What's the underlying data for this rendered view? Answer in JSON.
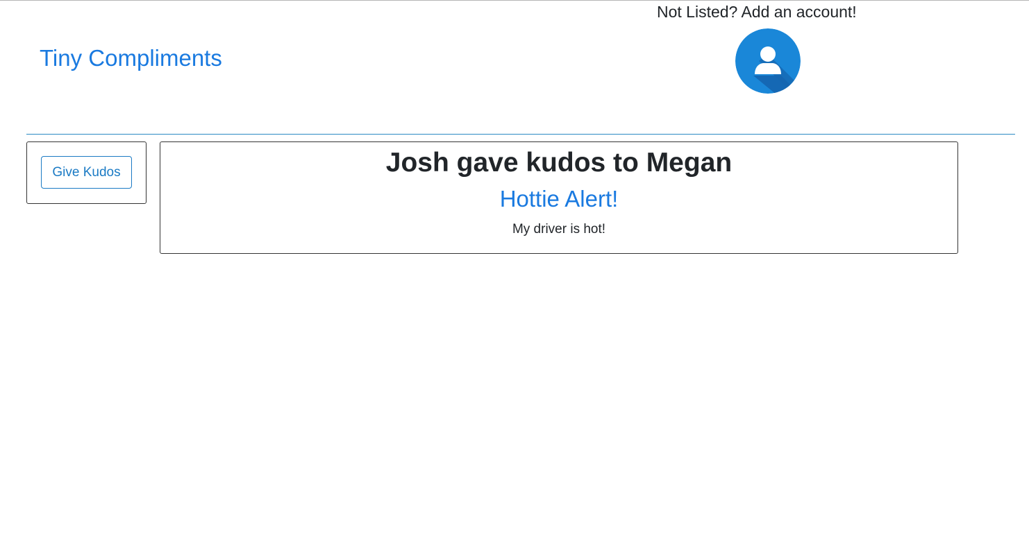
{
  "header": {
    "brand": "Tiny Compliments",
    "account_prompt": "Not Listed? Add an account!",
    "avatar_icon": "user-avatar-icon",
    "accent_color": "#1a7ae0",
    "avatar_color": "#1a87d8"
  },
  "sidebar": {
    "give_kudos_label": "Give Kudos"
  },
  "kudos": [
    {
      "heading": "Josh gave kudos to Megan",
      "title": "Hottie Alert!",
      "message": "My driver is hot!"
    }
  ]
}
